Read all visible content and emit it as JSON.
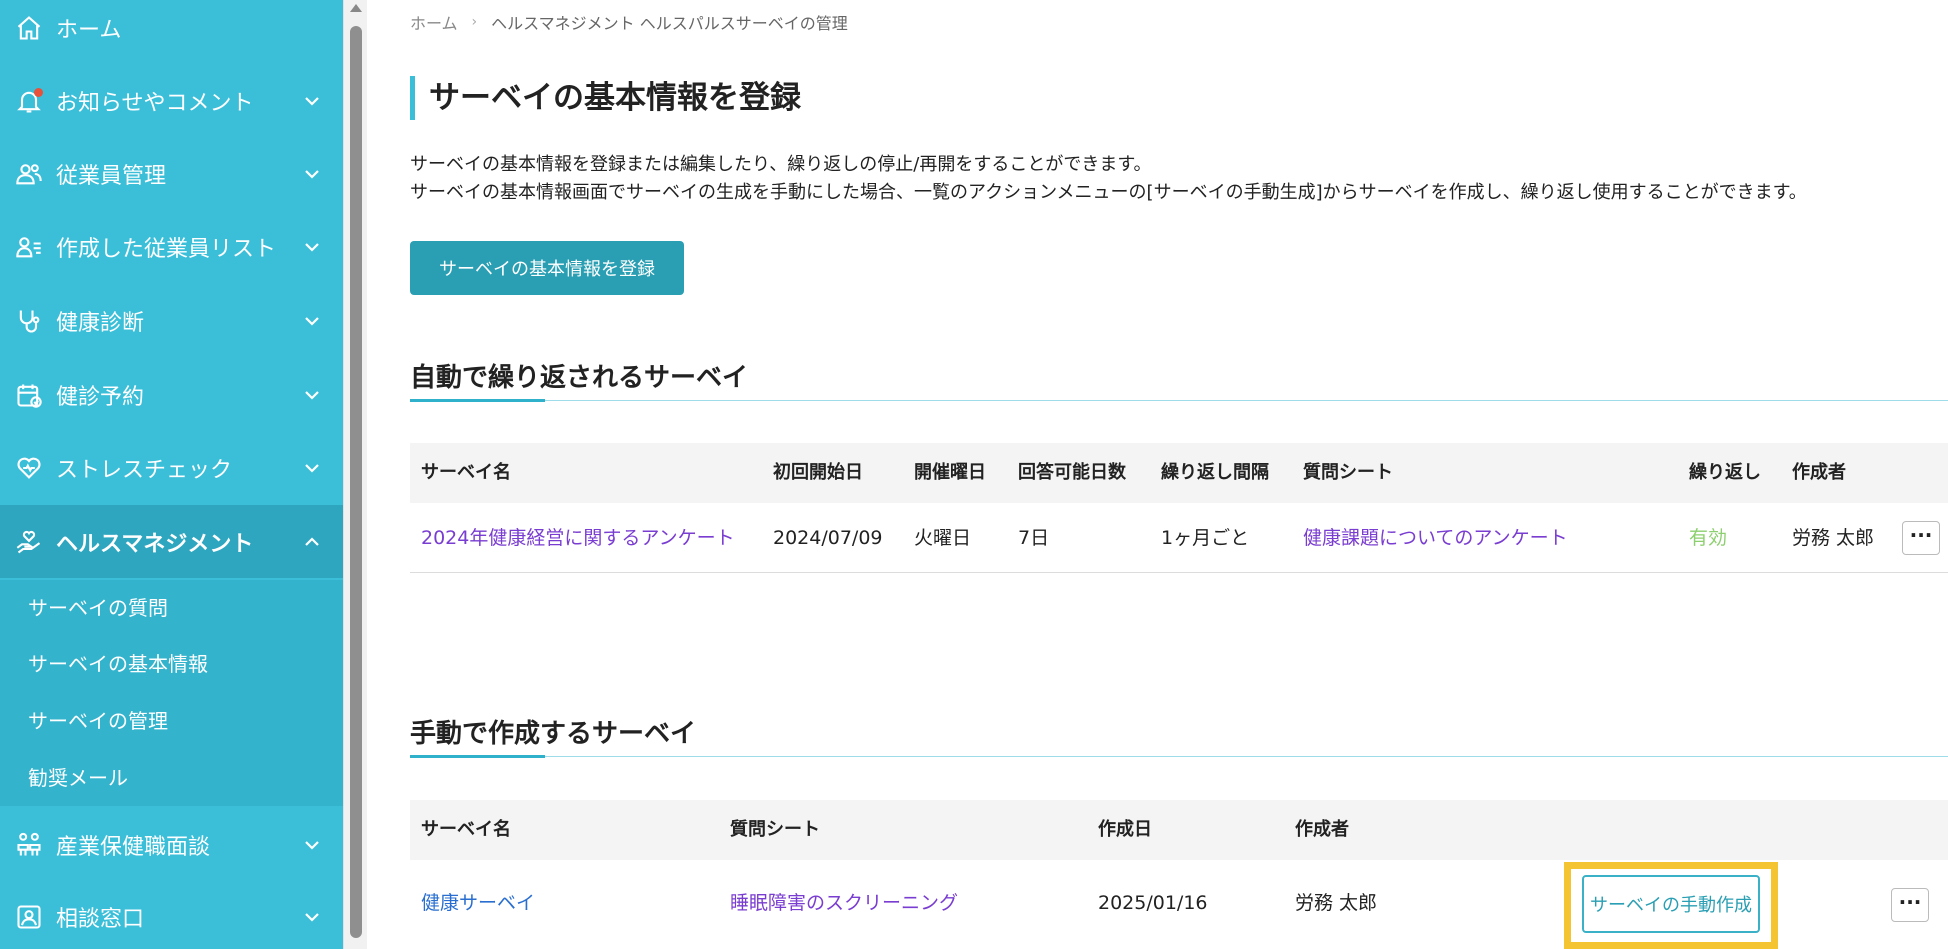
{
  "sidebar": {
    "items": [
      {
        "label": "ホーム",
        "icon": "home-icon"
      },
      {
        "label": "お知らせやコメント",
        "icon": "bell-icon"
      },
      {
        "label": "従業員管理",
        "icon": "users-icon"
      },
      {
        "label": "作成した従業員リスト",
        "icon": "user-list-icon"
      },
      {
        "label": "健康診断",
        "icon": "stethoscope-icon"
      },
      {
        "label": "健診予約",
        "icon": "calendar-check-icon"
      },
      {
        "label": "ストレスチェック",
        "icon": "heart-icon"
      },
      {
        "label": "ヘルスマネジメント",
        "icon": "heart-hand-icon"
      },
      {
        "label": "産業保健職面談",
        "icon": "people-icon"
      },
      {
        "label": "相談窓口",
        "icon": "contact-icon"
      }
    ],
    "sub_items": [
      "サーベイの質問",
      "サーベイの基本情報",
      "サーベイの管理",
      "勧奨メール"
    ]
  },
  "breadcrumb": {
    "home": "ホーム",
    "separator": "›",
    "current": "ヘルスマネジメント ヘルスパルスサーベイの管理"
  },
  "page": {
    "title": "サーベイの基本情報を登録",
    "desc1": "サーベイの基本情報を登録または編集したり、繰り返しの停止/再開をすることができます。",
    "desc2": "サーベイの基本情報画面でサーベイの生成を手動にした場合、一覧のアクションメニューの[サーベイの手動生成]からサーベイを作成し、繰り返し使用することができます。",
    "register_button": "サーベイの基本情報を登録"
  },
  "auto_section": {
    "title": "自動で繰り返されるサーベイ",
    "headers": {
      "name": "サーベイ名",
      "start": "初回開始日",
      "weekday": "開催曜日",
      "days": "回答可能日数",
      "interval": "繰り返し間隔",
      "sheet": "質問シート",
      "repeat": "繰り返し",
      "author": "作成者"
    },
    "rows": [
      {
        "name": "2024年健康経営に関するアンケート",
        "start": "2024/07/09",
        "weekday": "火曜日",
        "days": "7日",
        "interval": "1ヶ月ごと",
        "sheet": "健康課題についてのアンケート",
        "repeat": "有効",
        "author": "労務 太郎",
        "more": "···"
      }
    ]
  },
  "manual_section": {
    "title": "手動で作成するサーベイ",
    "headers": {
      "name": "サーベイ名",
      "sheet": "質問シート",
      "created": "作成日",
      "author": "作成者"
    },
    "rows": [
      {
        "name": "健康サーベイ",
        "sheet": "睡眠障害のスクリーニング",
        "created": "2025/01/16",
        "author": "労務 太郎",
        "action": "サーベイの手動作成",
        "more": "···"
      }
    ]
  },
  "colors": {
    "sidebar": "#3bbfd9",
    "sidebar_active": "#2ea6bf",
    "primary": "#2a9fb3",
    "highlight": "#f5c433",
    "link_blue": "#2a6fd0",
    "link_purple": "#7a3dd1",
    "status_on": "#8ccf6e"
  }
}
